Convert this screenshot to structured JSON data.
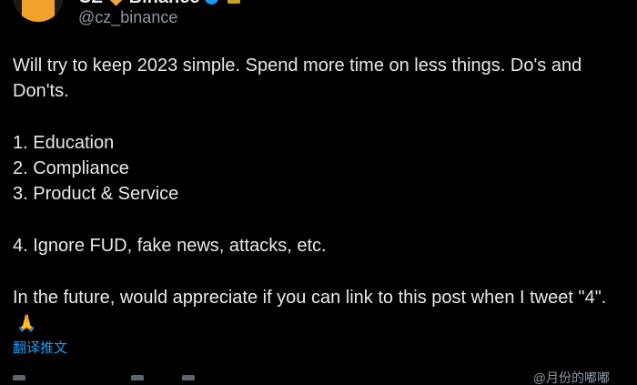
{
  "author": {
    "display_name": "CZ",
    "display_name_suffix": "Binance",
    "handle": "@cz_binance"
  },
  "tweet": {
    "line1": "Will try to keep 2023 simple. Spend more time on less things. Do's and Don'ts.",
    "item1": "1. Education",
    "item2": "2. Compliance",
    "item3": "3. Product & Service",
    "item4": "4. Ignore FUD, fake news, attacks, etc.",
    "closing": "In the future, would appreciate if you can link to this post when I tweet \"4\".",
    "emoji": "🙏"
  },
  "translate_label": "翻译推文",
  "watermark": "@月份的嘟嘟",
  "colors": {
    "background": "#000000",
    "text": "#e7e9ea",
    "secondary": "#8b98a5",
    "link": "#1d9bf0"
  }
}
